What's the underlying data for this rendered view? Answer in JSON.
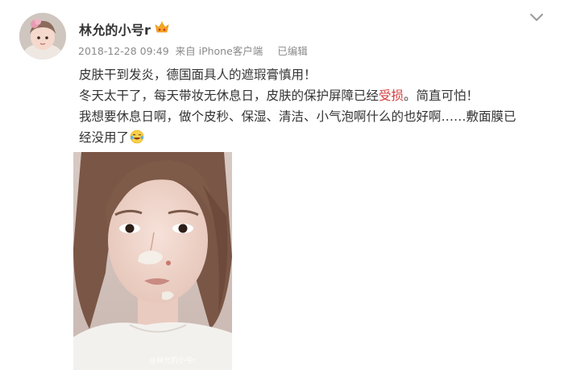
{
  "post": {
    "author": "林允的小号r",
    "timestamp": "2018-12-28 09:49",
    "source": "来自 iPhone客户端",
    "edited": "已编辑",
    "lines": {
      "l1": "皮肤干到发炎，德国面具人的遮瑕膏慎用！",
      "l2a": "冬天太干了，每天带妆无休息日，皮肤的保护屏障已经",
      "l2hl": "受损",
      "l2b": "。简直可怕！",
      "l3": "我想要休息日啊，做个皮秒、保湿、清洁、小气泡啊什么的也好啊……敷面膜已",
      "l4": "经没用了"
    },
    "watermark": "@林允的小号r",
    "accent": "#d63b3b"
  },
  "icons": [
    "avatar",
    "vip-crown-icon",
    "chevron-down-icon",
    "laughing-tears-emoji-icon"
  ]
}
